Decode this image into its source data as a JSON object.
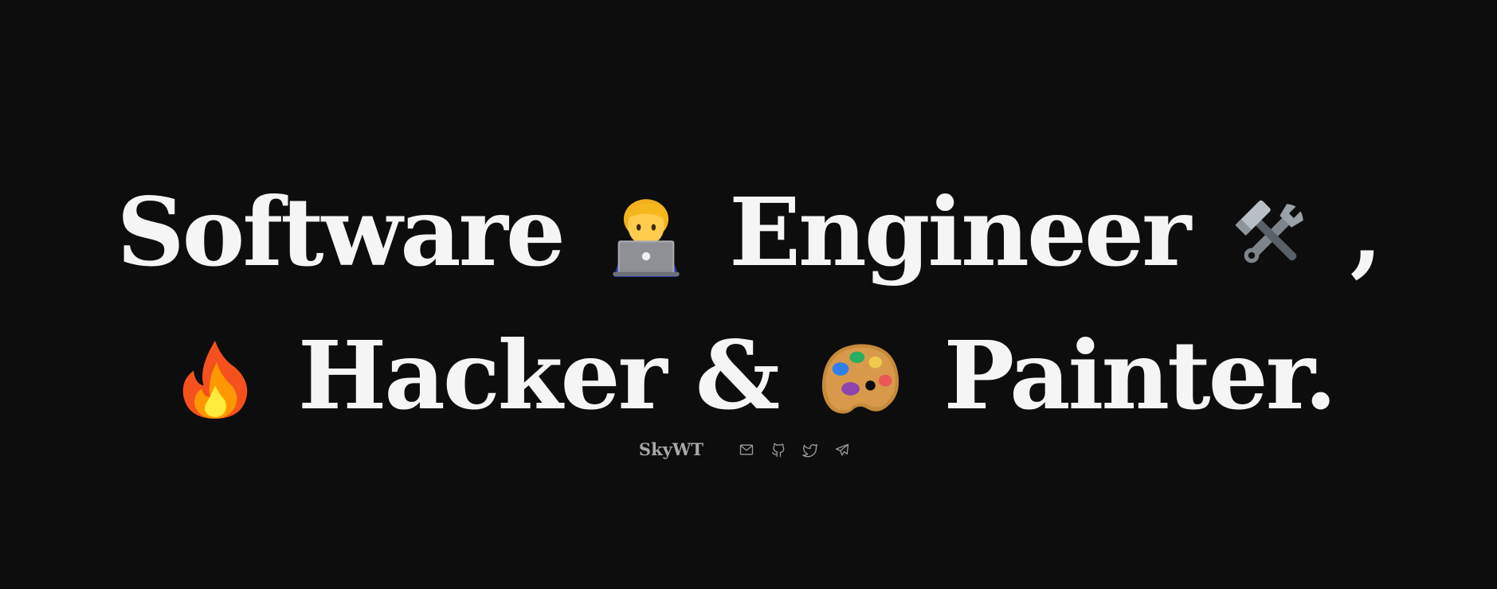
{
  "hero": {
    "line1": {
      "word1": "Software",
      "emoji1": "technologist-icon",
      "word2": "Engineer",
      "emoji2": "hammer-and-wrench-icon",
      "punct": ","
    },
    "line2": {
      "emoji1": "fire-icon",
      "word1": "Hacker &",
      "emoji2": "artist-palette-icon",
      "word2": "Painter."
    }
  },
  "footer": {
    "author": "SkyWT",
    "links": [
      {
        "icon": "mail-icon"
      },
      {
        "icon": "github-icon"
      },
      {
        "icon": "twitter-icon"
      },
      {
        "icon": "telegram-icon"
      }
    ]
  },
  "colors": {
    "background": "#0d0d0d",
    "headline": "#f5f5f5",
    "footer_text": "#a8a8a8"
  }
}
